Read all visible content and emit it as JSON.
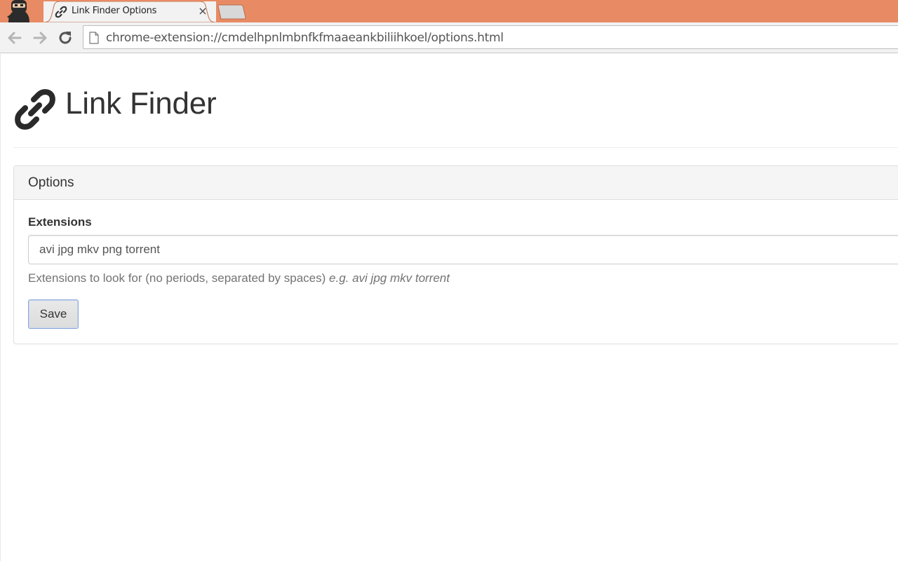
{
  "browser": {
    "tab": {
      "title": "Link Finder Options",
      "close_glyph": "×",
      "favicon": "link-icon"
    },
    "address_bar": {
      "url": "chrome-extension://cmdelhpnlmbnfkfmaaeankbiliihkoel/options.html"
    },
    "colors": {
      "tabstrip": "#e88b64",
      "toolbar": "#f2f2f2"
    }
  },
  "page": {
    "title": "Link Finder",
    "icon": "link-icon",
    "panel": {
      "heading": "Options",
      "field": {
        "label": "Extensions",
        "value": "avi jpg mkv png torrent",
        "help": "Extensions to look for (no periods, separated by spaces) ",
        "help_example": "e.g. avi jpg mkv torrent"
      },
      "save_label": "Save"
    }
  }
}
